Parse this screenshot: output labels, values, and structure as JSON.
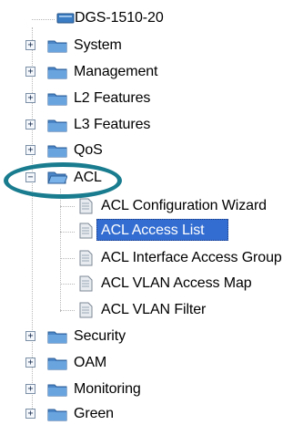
{
  "tree": {
    "root": {
      "label": "DGS-1510-20",
      "icon": "switch-device-icon"
    },
    "top_items": [
      {
        "label": "System",
        "expander": "+",
        "icon": "folder-icon"
      },
      {
        "label": "Management",
        "expander": "+",
        "icon": "folder-icon"
      },
      {
        "label": "L2 Features",
        "expander": "+",
        "icon": "folder-icon"
      },
      {
        "label": "L3 Features",
        "expander": "+",
        "icon": "folder-icon"
      },
      {
        "label": "QoS",
        "expander": "+",
        "icon": "folder-icon"
      },
      {
        "label": "ACL",
        "expander": "−",
        "icon": "open-folder-icon"
      }
    ],
    "acl_children": [
      {
        "label": "ACL Configuration Wizard",
        "icon": "page-icon"
      },
      {
        "label": "ACL Access List",
        "icon": "page-icon",
        "selected": true
      },
      {
        "label": "ACL Interface Access Group",
        "icon": "page-icon"
      },
      {
        "label": "ACL VLAN Access Map",
        "icon": "page-icon"
      },
      {
        "label": "ACL VLAN Filter",
        "icon": "page-icon"
      }
    ],
    "bottom_items": [
      {
        "label": "Security",
        "expander": "+",
        "icon": "folder-icon"
      },
      {
        "label": "OAM",
        "expander": "+",
        "icon": "folder-icon"
      },
      {
        "label": "Monitoring",
        "expander": "+",
        "icon": "folder-icon"
      },
      {
        "label": "Green",
        "expander": "+",
        "icon": "folder-icon"
      }
    ]
  },
  "colors": {
    "selection": "#336dd1",
    "highlight_ring": "#197c8f",
    "folder": "#4a86c8"
  }
}
